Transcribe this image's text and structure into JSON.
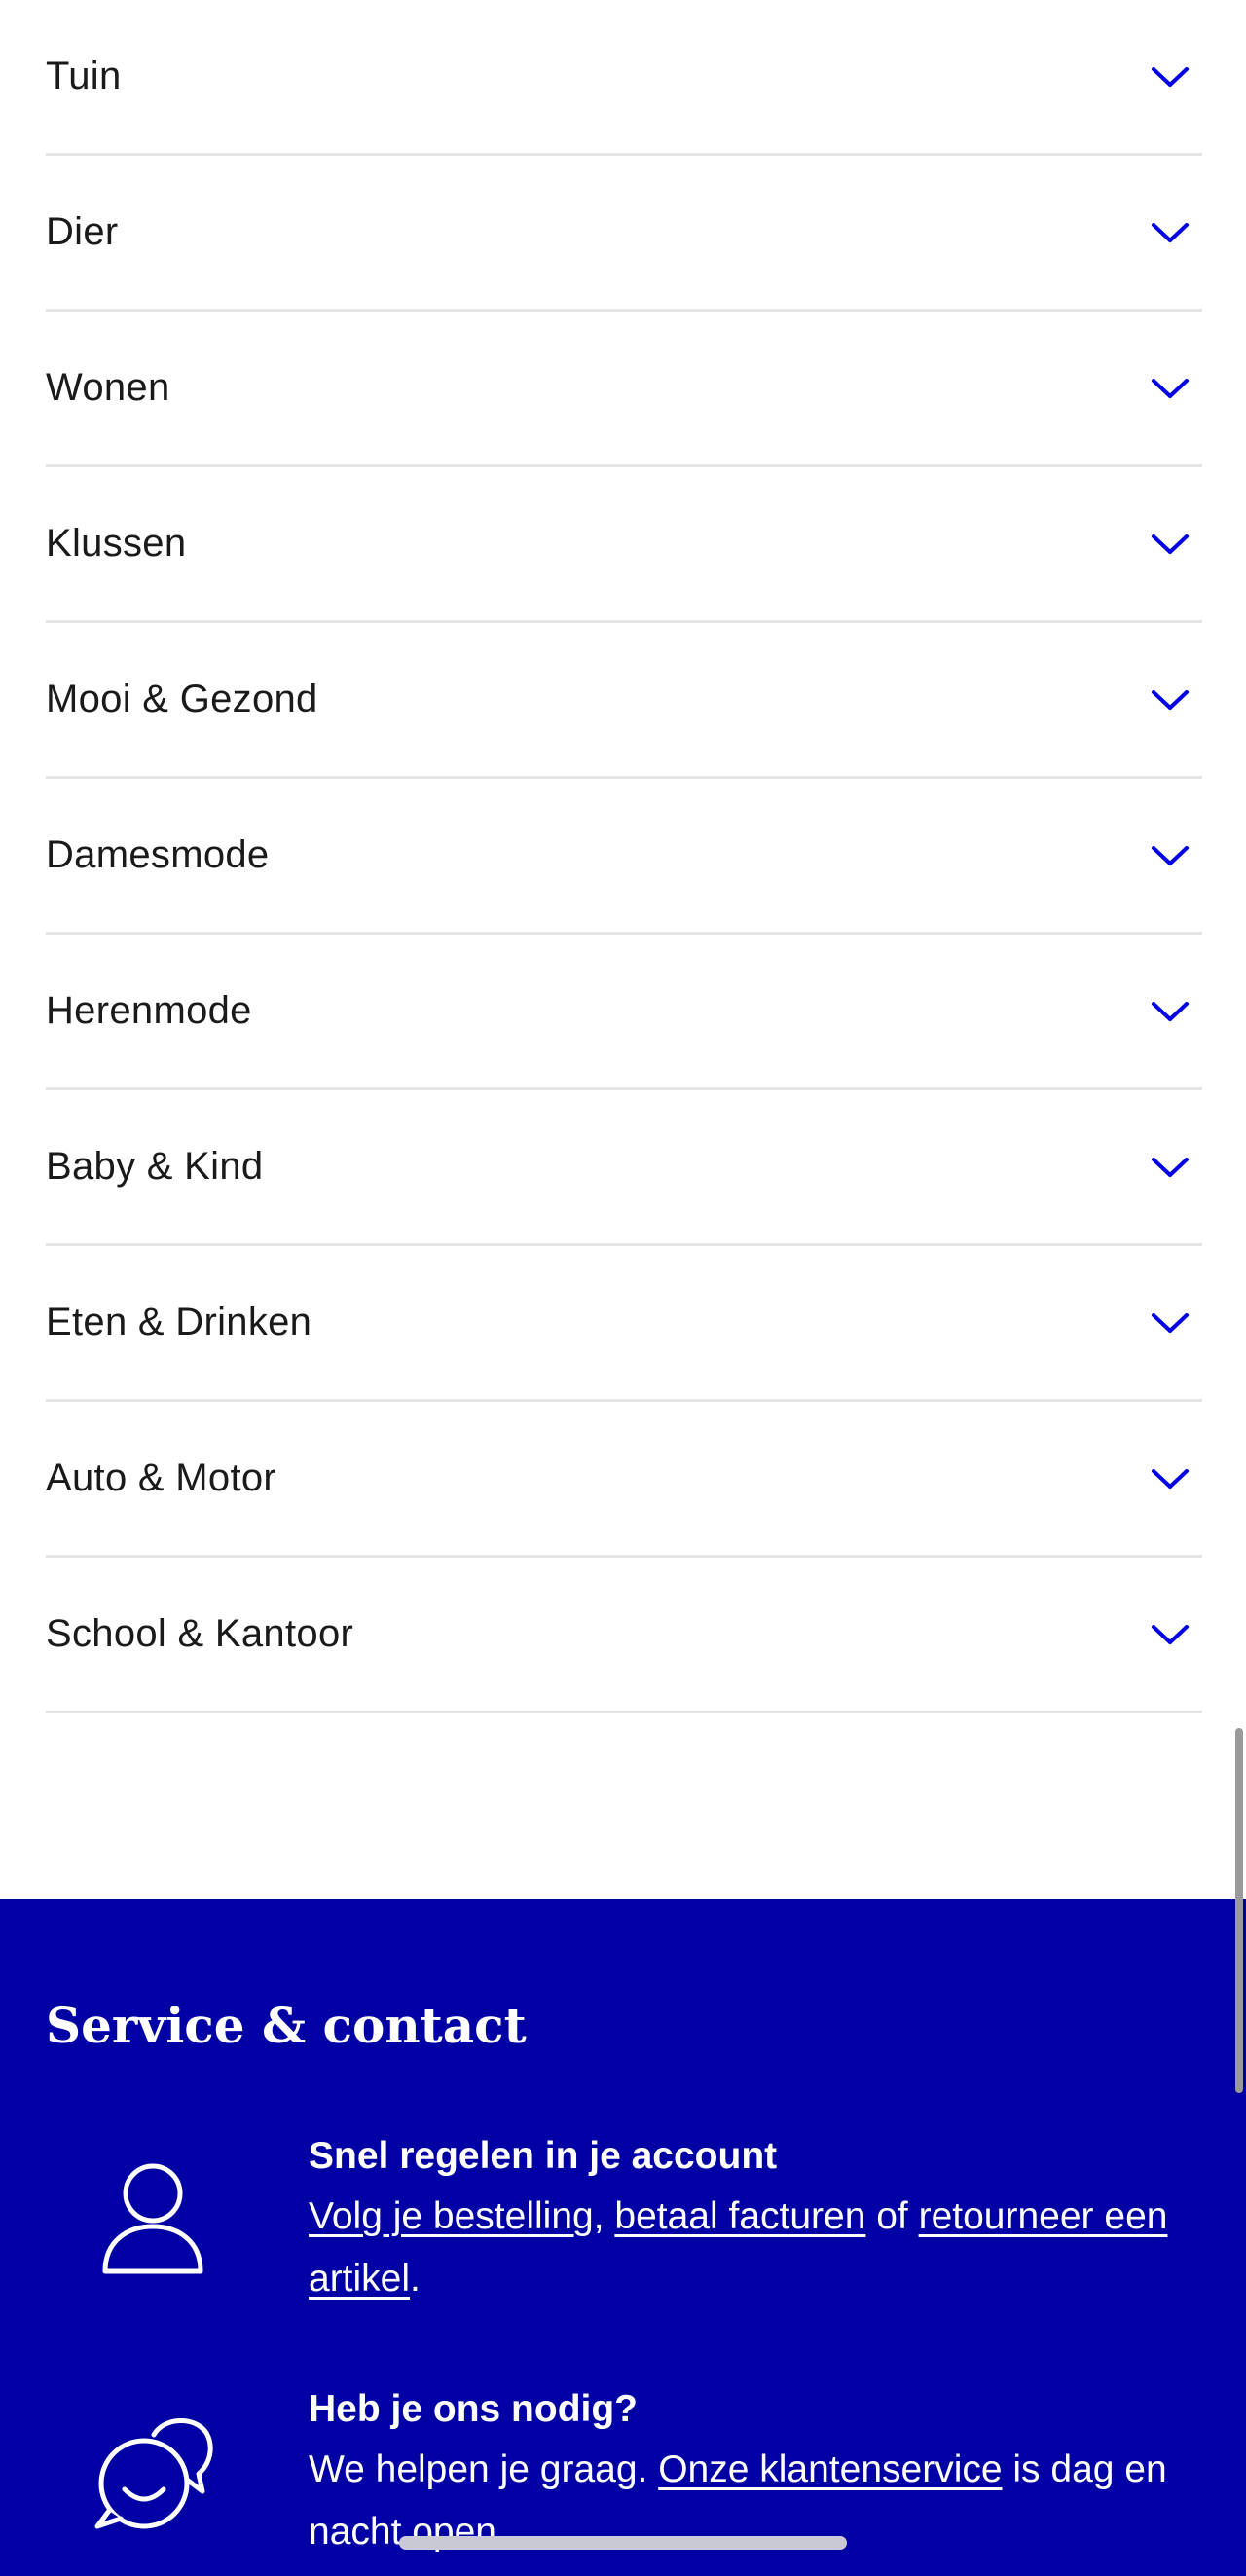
{
  "categories": [
    {
      "label": "Tuin"
    },
    {
      "label": "Dier"
    },
    {
      "label": "Wonen"
    },
    {
      "label": "Klussen"
    },
    {
      "label": "Mooi & Gezond"
    },
    {
      "label": "Damesmode"
    },
    {
      "label": "Herenmode"
    },
    {
      "label": "Baby & Kind"
    },
    {
      "label": "Eten & Drinken"
    },
    {
      "label": "Auto & Motor"
    },
    {
      "label": "School & Kantoor"
    }
  ],
  "footer": {
    "title": "Service & contact",
    "account": {
      "icon": "user-icon",
      "heading": "Snel regelen in je account",
      "link1": "Volg je bestelling",
      "sep1": ", ",
      "link2": "betaal facturen",
      "sep2": " of ",
      "link3": "retourneer een artikel",
      "end": "."
    },
    "help": {
      "icon": "chat-icon",
      "heading": "Heb je ons nodig?",
      "text1": "We helpen je graag. ",
      "link": "Onze klantenservice",
      "text2": " is dag en nacht open."
    }
  },
  "colors": {
    "accent": "#0000a4",
    "chevron": "#0000e6",
    "divider": "#e4e4e4"
  }
}
